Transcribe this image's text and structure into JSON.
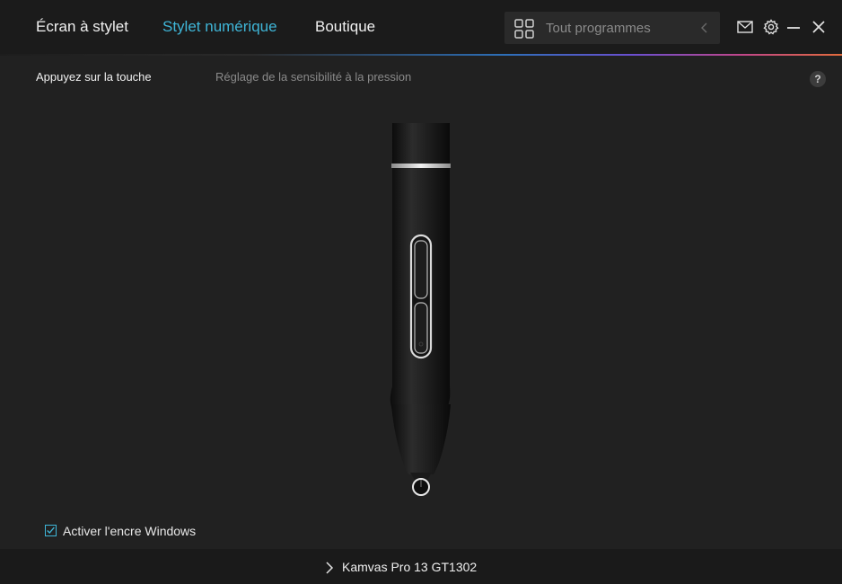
{
  "nav": {
    "tabs": [
      {
        "label": "Écran à stylet"
      },
      {
        "label": "Stylet numérique",
        "active": true
      },
      {
        "label": "Boutique"
      }
    ]
  },
  "program_selector": {
    "label": "Tout programmes",
    "icon": "grid-icon"
  },
  "window_controls": [
    "mail-icon",
    "gear-icon",
    "minimize-icon",
    "close-icon"
  ],
  "subtabs": [
    {
      "label": "Appuyez sur la touche",
      "active": true
    },
    {
      "label": "Réglage de la sensibilité à la pression"
    }
  ],
  "help": {
    "label": "?"
  },
  "windows_ink": {
    "label": "Activer l'encre Windows",
    "checked": true
  },
  "footer": {
    "device": "Kamvas Pro 13 GT1302"
  },
  "colors": {
    "accent": "#3fb6d8",
    "background": "#212121",
    "header": "#1b1b1b"
  }
}
